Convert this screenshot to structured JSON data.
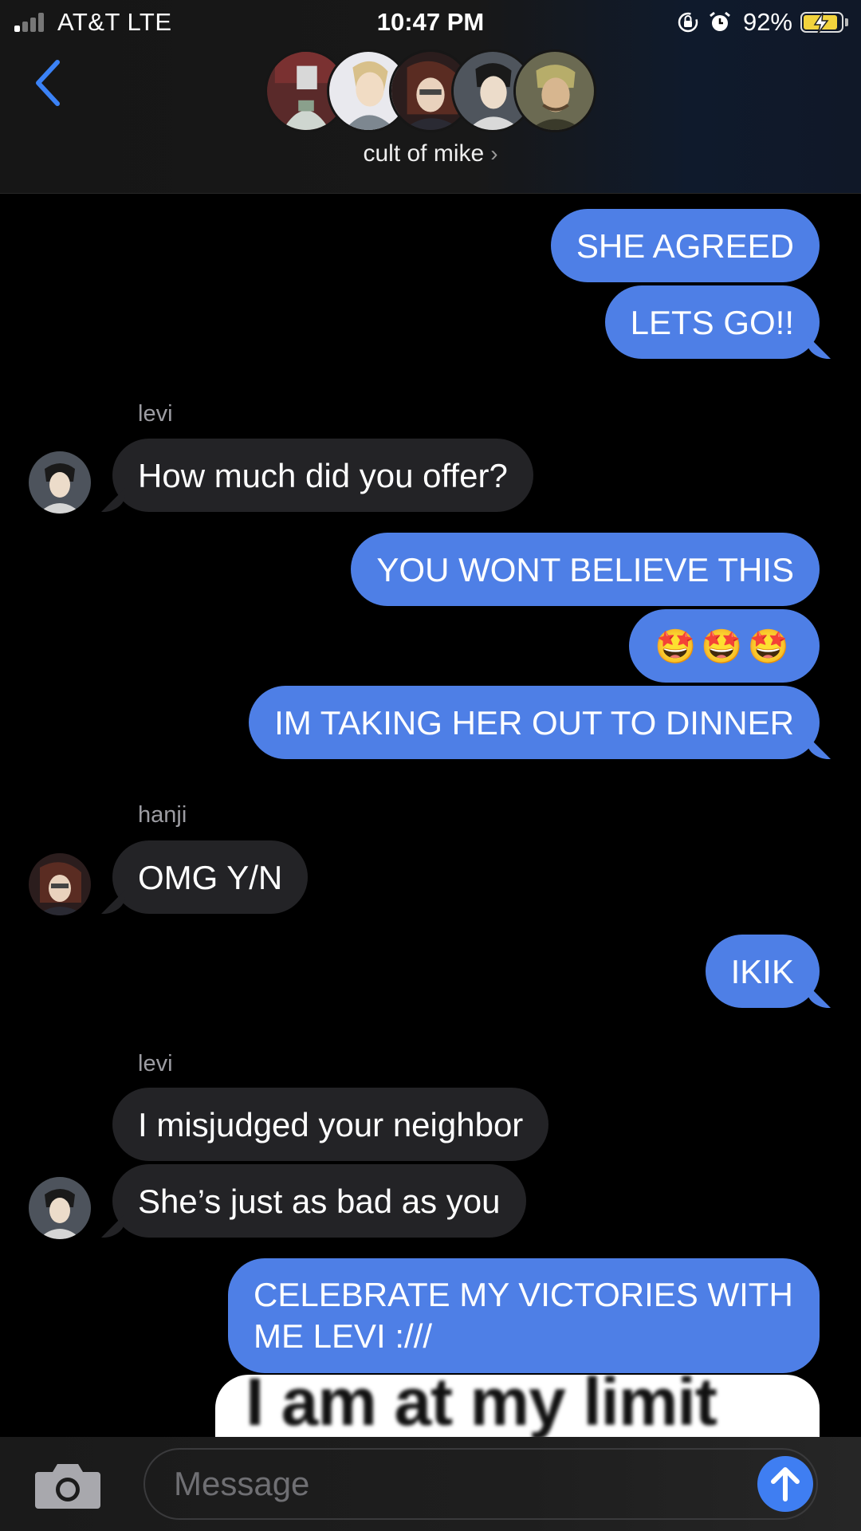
{
  "status_bar": {
    "carrier": "AT&T  LTE",
    "time": "10:47 PM",
    "battery_percent": "92%",
    "battery_level": 0.92,
    "icons": [
      "signal-icon",
      "orientation-lock-icon",
      "alarm-icon",
      "battery-charging-icon"
    ]
  },
  "header": {
    "group_name": "cult of mike",
    "chevron": "›",
    "back_icon": "chevron-left-icon",
    "avatar_count": 5
  },
  "messages": [
    {
      "direction": "sent",
      "text": "SHE AGREED"
    },
    {
      "direction": "sent",
      "text": "LETS GO!!"
    },
    {
      "direction": "received",
      "sender": "levi",
      "text": "How much did you offer?"
    },
    {
      "direction": "sent",
      "text": "YOU WONT BELIEVE THIS"
    },
    {
      "direction": "sent",
      "text": "🤩🤩🤩"
    },
    {
      "direction": "sent",
      "text": "IM TAKING HER OUT TO DINNER"
    },
    {
      "direction": "received",
      "sender": "hanji",
      "text": "OMG Y/N"
    },
    {
      "direction": "sent",
      "text": "IKIK"
    },
    {
      "direction": "received",
      "sender": "levi",
      "text": "I misjudged your neighbor"
    },
    {
      "direction": "received",
      "sender": "levi",
      "text": "She’s just as bad as you"
    },
    {
      "direction": "sent",
      "text": "CELEBRATE MY VICTORIES WITH ME LEVI :///"
    },
    {
      "direction": "sent",
      "type": "image",
      "text": "I am at my limit"
    }
  ],
  "input": {
    "placeholder": "Message",
    "camera_icon": "camera-icon",
    "send_icon": "arrow-up-icon"
  },
  "colors": {
    "sent_bubble": "#4e7fe6",
    "received_bubble": "#232326",
    "accent": "#3f7ef2",
    "background": "#000000"
  }
}
